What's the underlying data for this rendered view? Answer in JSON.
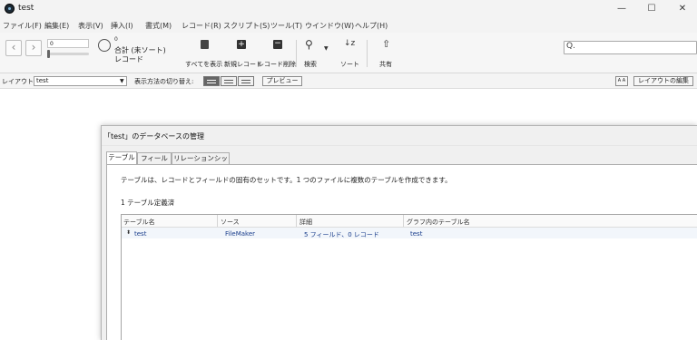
{
  "window": {
    "title": "test",
    "controls": {
      "minimize": "—",
      "maximize": "☐",
      "close": "✕"
    }
  },
  "menubar": {
    "items": [
      "ファイル(F)",
      "編集(E)",
      "表示(V)",
      "挿入(I)",
      "書式(M)",
      "レコード(R)",
      "スクリプト(S)",
      "ツール(T)",
      "ウインドウ(W)",
      "ヘルプ(H)"
    ]
  },
  "toolbar": {
    "back": "‹",
    "forward": "›",
    "record_number": "0",
    "found_count": "0",
    "total_label": "合計 (未ソート)",
    "records_label": "レコード",
    "show_all": "すべてを表示",
    "new_record": "新規レコード",
    "delete_record": "レコード削除",
    "find": "検索",
    "sort": "ソート",
    "share": "共有",
    "search_placeholder": "",
    "search_icon": "magnifier-icon"
  },
  "layoutbar": {
    "layout_label": "レイアウト:",
    "layout_value": "test",
    "view_as_label": "表示方法の切り替え:",
    "preview": "プレビュー",
    "aa": "A A",
    "edit_layout": "レイアウトの編集"
  },
  "dialog": {
    "title": "「test」のデータベースの管理",
    "tabs": [
      "テーブル",
      "フィールド",
      "リレーションシップ"
    ],
    "active_tab": "テーブル",
    "description": "テーブルは、レコードとフィールドの固有のセットです。1 つのファイルに複数のテーブルを作成できます。",
    "table_count": "1 テーブル定義済",
    "columns": [
      "テーブル名",
      "ソース",
      "詳細",
      "グラフ内のテーブル名"
    ],
    "rows": [
      {
        "name": "test",
        "source": "FileMaker",
        "details": "5 フィールド、0 レコード",
        "graph_name": "test"
      }
    ]
  }
}
